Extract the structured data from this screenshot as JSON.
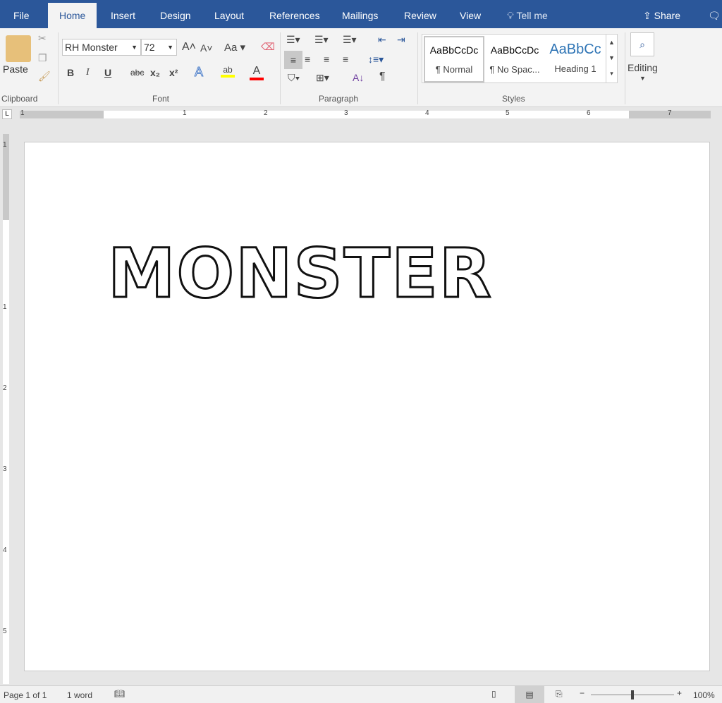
{
  "tabs": [
    {
      "label": "File"
    },
    {
      "label": "Home"
    },
    {
      "label": "Insert"
    },
    {
      "label": "Design"
    },
    {
      "label": "Layout"
    },
    {
      "label": "References"
    },
    {
      "label": "Mailings"
    },
    {
      "label": "Review"
    },
    {
      "label": "View"
    }
  ],
  "tell_me": "Tell me",
  "share": "Share",
  "ribbon": {
    "clipboard": {
      "paste": "Paste",
      "label": "Clipboard"
    },
    "font": {
      "name": "RH Monster",
      "size": "72",
      "label": "Font",
      "case": "Aa",
      "bold": "B",
      "italic": "I",
      "underline": "U",
      "strike": "abc",
      "sub": "x₂",
      "sup": "x²",
      "highlight_color": "#ffff00",
      "font_color": "#ff0000"
    },
    "paragraph": {
      "label": "Paragraph"
    },
    "styles": {
      "label": "Styles",
      "items": [
        {
          "preview": "AaBbCcDc",
          "name": "¶ Normal"
        },
        {
          "preview": "AaBbCcDc",
          "name": "¶ No Spac..."
        },
        {
          "preview": "AaBbCc",
          "name": "Heading 1"
        }
      ]
    },
    "editing": {
      "label": "Editing"
    }
  },
  "ruler": {
    "marks": [
      "1",
      "1",
      "2",
      "3",
      "4",
      "5",
      "6",
      "7"
    ]
  },
  "vruler": {
    "marks": [
      "1",
      "1",
      "2",
      "3",
      "4",
      "5"
    ]
  },
  "document": {
    "text": "MONSTER"
  },
  "status": {
    "page": "Page 1 of 1",
    "words": "1 word",
    "zoom": "100%",
    "zoom_level": 100
  },
  "colors": {
    "accent": "#2b579a"
  }
}
